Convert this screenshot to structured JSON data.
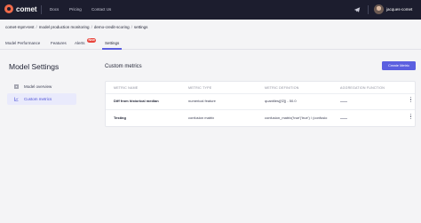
{
  "brand": {
    "name": "comet",
    "accent": "#5b5fe0",
    "logo_color": "#f06a4a"
  },
  "topnav": {
    "items": [
      "Docs",
      "Pricing",
      "Contact Us"
    ]
  },
  "user": {
    "name": "jacques-comet"
  },
  "breadcrumb": [
    "comet-mpm-test",
    "model production monitoring",
    "demo-credit-scoring",
    "settings"
  ],
  "tabs": {
    "items": [
      "Model Performance",
      "Features",
      "Alerts",
      "Settings"
    ],
    "alerts_badge": "New",
    "active": "Settings"
  },
  "sidebar": {
    "title": "Model Settings",
    "items": [
      {
        "label": "Model overview",
        "icon": "grid-icon"
      },
      {
        "label": "Custom metrics",
        "icon": "chart-icon",
        "active": true
      }
    ]
  },
  "main": {
    "title": "Custom metrics",
    "create_button": "Create Metric",
    "columns": [
      "METRIC NAME",
      "METRIC TYPE",
      "METRIC DEFINITION",
      "AGGREGATION FUNCTION"
    ],
    "rows": [
      {
        "name": "Diff from historical median",
        "type": "numerical feature",
        "definition": "quantiles([f2]) - 50.0",
        "aggregation": ""
      },
      {
        "name": "Testing",
        "type": "confusion matrix",
        "definition": "confusion_matrix('true'|'true') / (confusio",
        "aggregation": ""
      }
    ]
  }
}
